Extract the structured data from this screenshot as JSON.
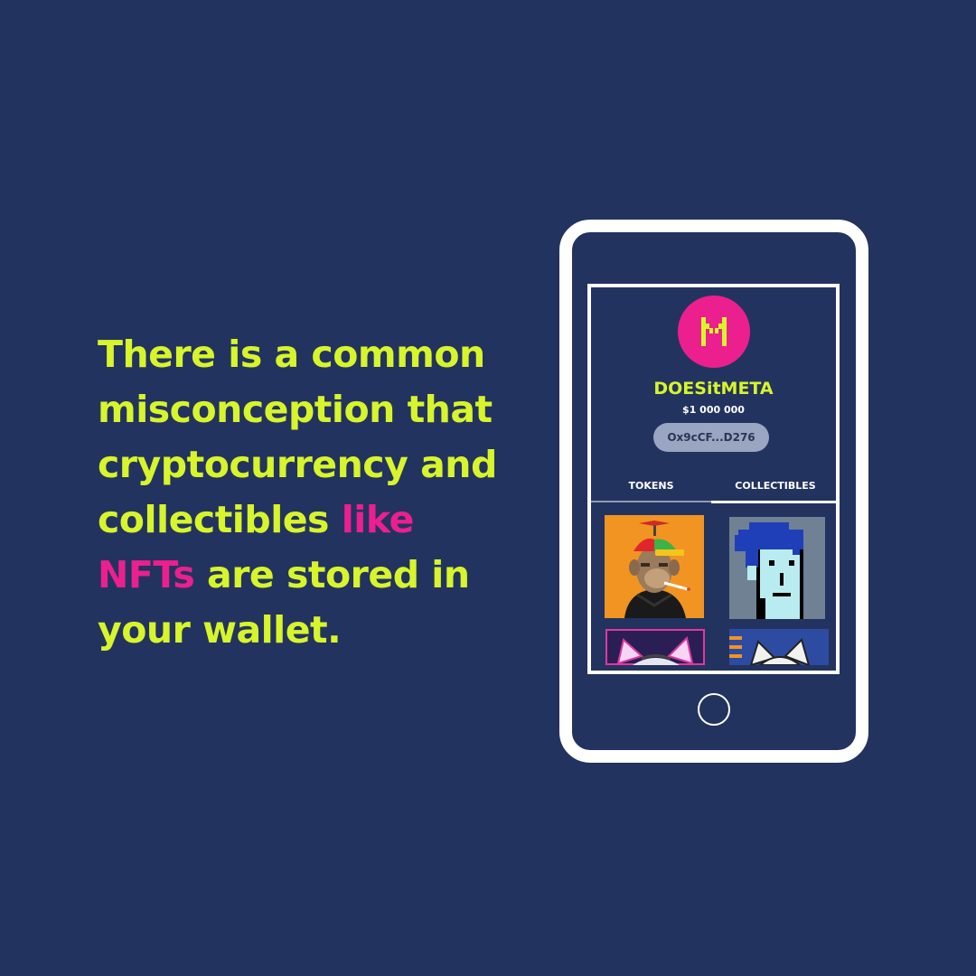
{
  "headline": {
    "part1": "There is a common misconception that cryptocurrency and collectibles ",
    "highlight": "like NFTs",
    "part2": " are stored in your wallet."
  },
  "wallet": {
    "avatar_icon": "metamask-logo-icon",
    "username": "DOESitMETA",
    "balance": "$1 000 000",
    "address": "Ox9cCF...D276",
    "tabs": [
      "TOKENS",
      "COLLECTIBLES"
    ],
    "active_tab": "COLLECTIBLES",
    "collectibles": [
      "ape-nft",
      "punk-nft",
      "cat-nft",
      "cat-nft"
    ]
  },
  "colors": {
    "background": "#233360",
    "headline": "#d7f52a",
    "highlight": "#ec1f8f",
    "phone_frame": "#ffffff"
  }
}
